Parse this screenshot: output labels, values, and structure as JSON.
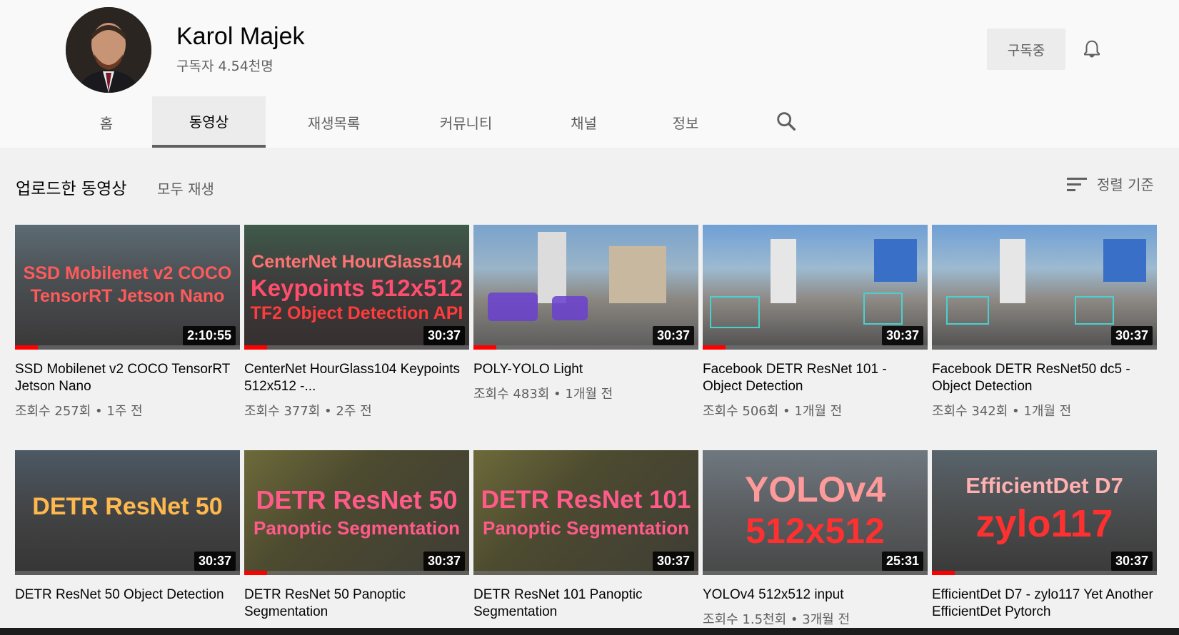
{
  "channel": {
    "name": "Karol Majek",
    "subscribers": "구독자 4.54천명",
    "subscribed_label": "구독중"
  },
  "tabs": [
    {
      "label": "홈",
      "active": false
    },
    {
      "label": "동영상",
      "active": true
    },
    {
      "label": "재생목록",
      "active": false
    },
    {
      "label": "커뮤니티",
      "active": false
    },
    {
      "label": "채널",
      "active": false
    },
    {
      "label": "정보",
      "active": false
    }
  ],
  "section": {
    "title": "업로드한 동영상",
    "play_all": "모두 재생",
    "sort_label": "정렬 기준"
  },
  "videos": [
    {
      "title": "SSD Mobilenet v2 COCO TensorRT Jetson Nano",
      "views": "조회수 257회",
      "age": "1주 전",
      "duration": "2:10:55",
      "progress": 0.1,
      "thumb_lines": [
        "SSD Mobilenet v2 COCO",
        "TensorRT Jetson Nano"
      ],
      "thumb_colors": [
        "#ff5a5a",
        "#ff5a5a"
      ]
    },
    {
      "title": "CenterNet HourGlass104 Keypoints 512x512 -...",
      "views": "조회수 377회",
      "age": "2주 전",
      "duration": "30:37",
      "progress": 0.1,
      "thumb_lines": [
        "CenterNet HourGlass104",
        "Keypoints 512x512",
        "TF2 Object Detection API"
      ],
      "thumb_colors": [
        "#ff7373",
        "#ff4d6d",
        "#ff3b3b"
      ]
    },
    {
      "title": "POLY-YOLO Light",
      "views": "조회수 483회",
      "age": "1개월 전",
      "duration": "30:37",
      "progress": 0.1,
      "thumb_lines": [],
      "thumb_colors": []
    },
    {
      "title": "Facebook DETR ResNet 101 - Object Detection",
      "views": "조회수 506회",
      "age": "1개월 전",
      "duration": "30:37",
      "progress": 0.1,
      "thumb_lines": [],
      "thumb_colors": []
    },
    {
      "title": "Facebook DETR ResNet50 dc5 - Object Detection",
      "views": "조회수 342회",
      "age": "1개월 전",
      "duration": "30:37",
      "progress": 0,
      "thumb_lines": [],
      "thumb_colors": []
    },
    {
      "title": "DETR ResNet 50 Object Detection",
      "views": "",
      "age": "",
      "duration": "30:37",
      "progress": 0,
      "thumb_lines": [
        "DETR ResNet 50"
      ],
      "thumb_colors": [
        "#ffb84d"
      ]
    },
    {
      "title": "DETR ResNet 50 Panoptic Segmentation",
      "views": "",
      "age": "",
      "duration": "30:37",
      "progress": 0.1,
      "thumb_lines": [
        "DETR ResNet 50",
        "Panoptic Segmentation"
      ],
      "thumb_colors": [
        "#ff5a8a",
        "#ff5a8a"
      ]
    },
    {
      "title": "DETR ResNet 101 Panoptic Segmentation",
      "views": "",
      "age": "",
      "duration": "30:37",
      "progress": 0,
      "thumb_lines": [
        "DETR ResNet 101",
        "Panoptic Segmentation"
      ],
      "thumb_colors": [
        "#ff5a8a",
        "#ff5a8a"
      ]
    },
    {
      "title": "YOLOv4 512x512 input",
      "views": "조회수 1.5천회",
      "age": "3개월 전",
      "duration": "25:31",
      "progress": 0,
      "thumb_lines": [
        "YOLOv4",
        "512x512"
      ],
      "thumb_colors": [
        "#ff9a9a",
        "#ff3030"
      ]
    },
    {
      "title": "EfficientDet D7 - zylo117 Yet Another EfficientDet Pytorch",
      "views": "",
      "age": "",
      "duration": "30:37",
      "progress": 0.1,
      "thumb_lines": [
        "EfficientDet D7",
        "zylo117"
      ],
      "thumb_colors": [
        "#ffb0b0",
        "#ff3030"
      ]
    }
  ],
  "colors": {
    "progress": "#ff0000",
    "tab_active_bg": "#ececec"
  }
}
